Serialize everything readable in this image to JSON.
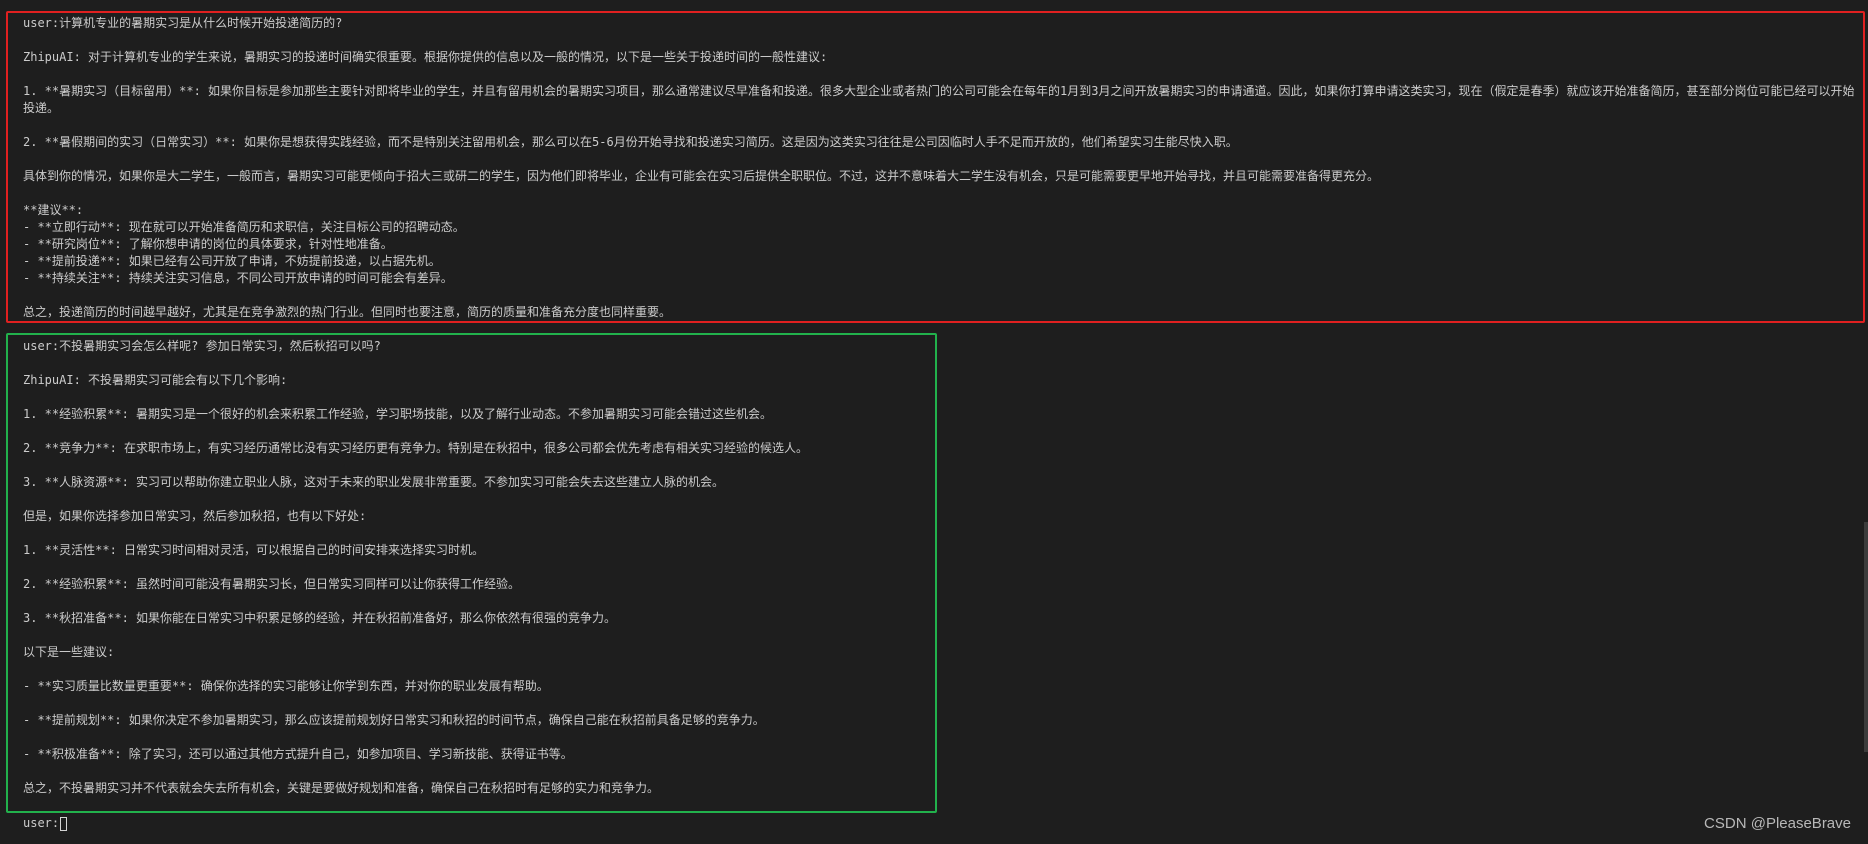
{
  "conversation": {
    "block1": [
      "user:计算机专业的暑期实习是从什么时候开始投递简历的?",
      "",
      "ZhipuAI: 对于计算机专业的学生来说，暑期实习的投递时间确实很重要。根据你提供的信息以及一般的情况，以下是一些关于投递时间的一般性建议:",
      "",
      "1. **暑期实习（目标留用）**: 如果你目标是参加那些主要针对即将毕业的学生，并且有留用机会的暑期实习项目，那么通常建议尽早准备和投递。很多大型企业或者热门的公司可能会在每年的1月到3月之间开放暑期实习的申请通道。因此，如果你打算申请这类实习，现在（假定是春季）就应该开始准备简历，甚至部分岗位可能已经可以开始投递。",
      "",
      "2. **暑假期间的实习（日常实习）**: 如果你是想获得实践经验，而不是特别关注留用机会，那么可以在5-6月份开始寻找和投递实习简历。这是因为这类实习往往是公司因临时人手不足而开放的，他们希望实习生能尽快入职。",
      "",
      "具体到你的情况，如果你是大二学生，一般而言，暑期实习可能更倾向于招大三或研二的学生，因为他们即将毕业，企业有可能会在实习后提供全职职位。不过，这并不意味着大二学生没有机会，只是可能需要更早地开始寻找，并且可能需要准备得更充分。",
      "",
      "**建议**:",
      "- **立即行动**: 现在就可以开始准备简历和求职信，关注目标公司的招聘动态。",
      "- **研究岗位**: 了解你想申请的岗位的具体要求，针对性地准备。",
      "- **提前投递**: 如果已经有公司开放了申请，不妨提前投递，以占据先机。",
      "- **持续关注**: 持续关注实习信息，不同公司开放申请的时间可能会有差异。",
      "",
      "总之，投递简历的时间越早越好，尤其是在竞争激烈的热门行业。但同时也要注意，简历的质量和准备充分度也同样重要。"
    ],
    "block2": [
      "user:不投暑期实习会怎么样呢? 参加日常实习，然后秋招可以吗?",
      "",
      "ZhipuAI: 不投暑期实习可能会有以下几个影响:",
      "",
      "1. **经验积累**: 暑期实习是一个很好的机会来积累工作经验，学习职场技能，以及了解行业动态。不参加暑期实习可能会错过这些机会。",
      "",
      "2. **竞争力**: 在求职市场上，有实习经历通常比没有实习经历更有竞争力。特别是在秋招中，很多公司都会优先考虑有相关实习经验的候选人。",
      "",
      "3. **人脉资源**: 实习可以帮助你建立职业人脉，这对于未来的职业发展非常重要。不参加实习可能会失去这些建立人脉的机会。",
      "",
      "但是，如果你选择参加日常实习，然后参加秋招，也有以下好处:",
      "",
      "1. **灵活性**: 日常实习时间相对灵活，可以根据自己的时间安排来选择实习时机。",
      "",
      "2. **经验积累**: 虽然时间可能没有暑期实习长，但日常实习同样可以让你获得工作经验。",
      "",
      "3. **秋招准备**: 如果你能在日常实习中积累足够的经验，并在秋招前准备好，那么你依然有很强的竞争力。",
      "",
      "以下是一些建议:",
      "",
      "- **实习质量比数量更重要**: 确保你选择的实习能够让你学到东西，并对你的职业发展有帮助。",
      "",
      "- **提前规划**: 如果你决定不参加暑期实习，那么应该提前规划好日常实习和秋招的时间节点，确保自己能在秋招前具备足够的竞争力。",
      "",
      "- **积极准备**: 除了实习，还可以通过其他方式提升自己，如参加项目、学习新技能、获得证书等。",
      "",
      "总之，不投暑期实习并不代表就会失去所有机会，关键是要做好规划和准备，确保自己在秋招时有足够的实力和竞争力。"
    ]
  },
  "prompt": {
    "label": "user:"
  },
  "watermark": "CSDN @PleaseBrave",
  "colors": {
    "background": "#1e1e1e",
    "text": "#cccccc",
    "highlight_red": "#e02020",
    "highlight_green": "#22b14c"
  }
}
